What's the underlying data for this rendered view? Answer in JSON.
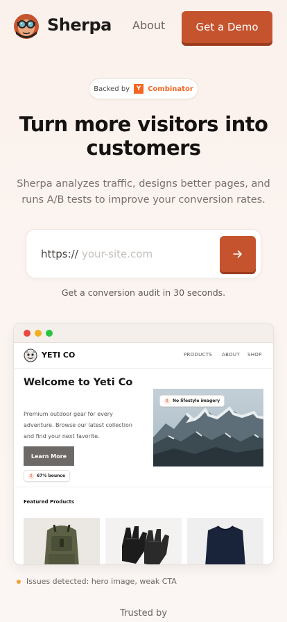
{
  "header": {
    "brand": "Sherpa",
    "nav_about": "About",
    "demo_button": "Get a Demo"
  },
  "backed": {
    "label": "Backed by",
    "yc_letter": "Y",
    "yc_name": "Combinator"
  },
  "hero": {
    "headline_line1": "Turn more visitors into",
    "headline_line2": "customers",
    "subhead": "Sherpa analyzes traffic, designs better pages, and runs A/B tests to improve your conversion rates."
  },
  "url_form": {
    "prefix": "https://",
    "placeholder": "your-site.com",
    "value": ""
  },
  "caption": "Get a conversion audit in 30 seconds.",
  "preview": {
    "site_name": "YETI CO",
    "nav": [
      "PRODUCTS",
      "ABOUT",
      "SHOP"
    ],
    "title": "Welcome to Yeti Co",
    "description": "Premium outdoor gear for every adventure. Browse our latest collection and find your next favorite.",
    "cta": "Learn More",
    "badge_image": "No lifestyle imagery",
    "badge_bounce": "67% bounce",
    "featured_label": "Featured Products"
  },
  "issues": "Issues detected: hero image, weak CTA",
  "trusted": "Trusted by",
  "colors": {
    "accent": "#c4532e",
    "accent_shadow": "#9c3b1d",
    "yc_orange": "#f26522",
    "issue_dot": "#f0a23a"
  },
  "icons": {
    "logo": "sherpa-goggles-logo",
    "submit": "arrow-right-icon",
    "warning": "warning-icon"
  }
}
